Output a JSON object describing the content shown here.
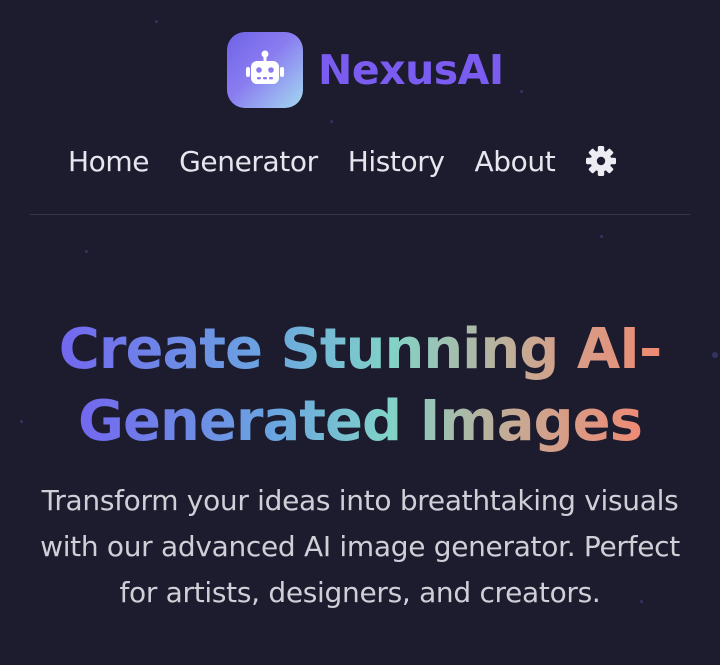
{
  "brand": {
    "name": "NexusAI",
    "logo_icon": "robot-icon"
  },
  "nav": {
    "items": [
      {
        "label": "Home"
      },
      {
        "label": "Generator"
      },
      {
        "label": "History"
      },
      {
        "label": "About"
      }
    ],
    "settings_icon": "gear-icon"
  },
  "hero": {
    "title_line1": "Create Stunning AI-",
    "title_line2": "Generated Images",
    "subtitle": "Transform your ideas into breathtaking visuals with our advanced AI image generator. Perfect for artists, designers, and creators."
  },
  "colors": {
    "background": "#1c1c2e",
    "brand_accent": "#7b5cf0",
    "gradient_start": "#7367ef",
    "gradient_mid": "#81d3c7",
    "gradient_end": "#ee8a74",
    "nav_text": "#e7e6ef",
    "body_text": "#cfcfd8"
  }
}
